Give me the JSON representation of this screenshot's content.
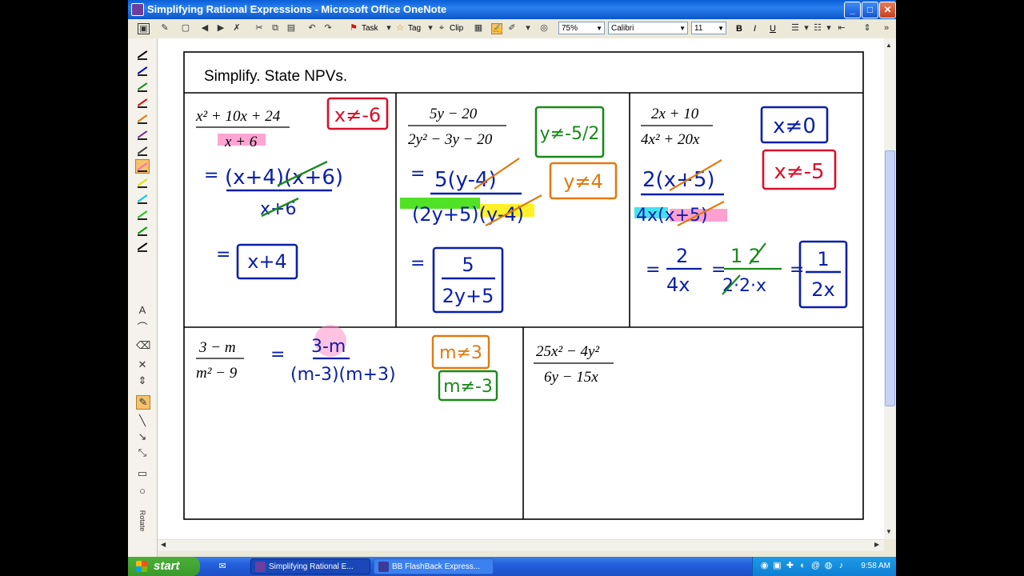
{
  "window": {
    "title": "Simplifying Rational Expressions - Microsoft Office OneNote",
    "minimize": "_",
    "maximize": "□",
    "close": "✕"
  },
  "toolbar": {
    "task_label": "Task",
    "tag_label": "Tag",
    "clip_label": "Clip",
    "zoom": "75%",
    "font": "Calibri",
    "font_size": "11",
    "bold": "B",
    "italic": "I",
    "underline": "U"
  },
  "pen_tray": {
    "pen_colors": [
      "#000000",
      "#0000c8",
      "#1a8a1a",
      "#d01010",
      "#e07a00",
      "#7a2a9a",
      "#3a3a3a",
      "#ff6fb0",
      "#e0e000",
      "#00c8e6",
      "#20c020",
      "#00a000",
      "#000000"
    ],
    "rotate_label": "Rotate"
  },
  "note": {
    "heading": "Simplify.  State NPVs.",
    "problems": {
      "p1": {
        "num": "x² + 10x + 24",
        "den": "x + 6",
        "npv": "x≠-6",
        "step1_num": "(x+4)(x+6)",
        "step1_den": "x+6",
        "answer": "x+4"
      },
      "p2": {
        "num": "5y − 20",
        "den": "2y² − 3y − 20",
        "npv1": "y≠-5/2",
        "npv2": "y≠4",
        "step1_num": "5(y-4)",
        "step1_den": "(2y+5)(y-4)",
        "answer_num": "5",
        "answer_den": "2y+5"
      },
      "p3": {
        "num": "2x + 10",
        "den": "4x² + 20x",
        "npv1": "x≠0",
        "npv2": "x≠-5",
        "step1_num": "2(x+5)",
        "step1_den": "4x(x+5)",
        "step2_num": "2",
        "step2_den": "4x",
        "step3_num": "1 2",
        "step3_den": "2·2·x",
        "answer_num": "1",
        "answer_den": "2x"
      },
      "p4": {
        "num": "3 − m",
        "den": "m² − 9",
        "step1_num": "3-m",
        "step1_den": "(m-3)(m+3)",
        "npv1": "m≠3",
        "npv2": "m≠-3"
      },
      "p5": {
        "num": "25x² − 4y²",
        "den": "6y − 15x"
      }
    },
    "equals": "="
  },
  "taskbar": {
    "start_label": "start",
    "tasks": [
      "Simplifying Rational E...",
      "BB FlashBack Express..."
    ],
    "clock": "9:58 AM"
  },
  "colors": {
    "ink_blue": "#0a1fa8",
    "ink_red": "#d8102a",
    "ink_green": "#1a8a1a",
    "ink_orange": "#e07a10",
    "highlight_pink": "#ff8fc8",
    "highlight_green": "#33dd00",
    "highlight_yellow": "#ffee00",
    "highlight_cyan": "#22ddee"
  }
}
